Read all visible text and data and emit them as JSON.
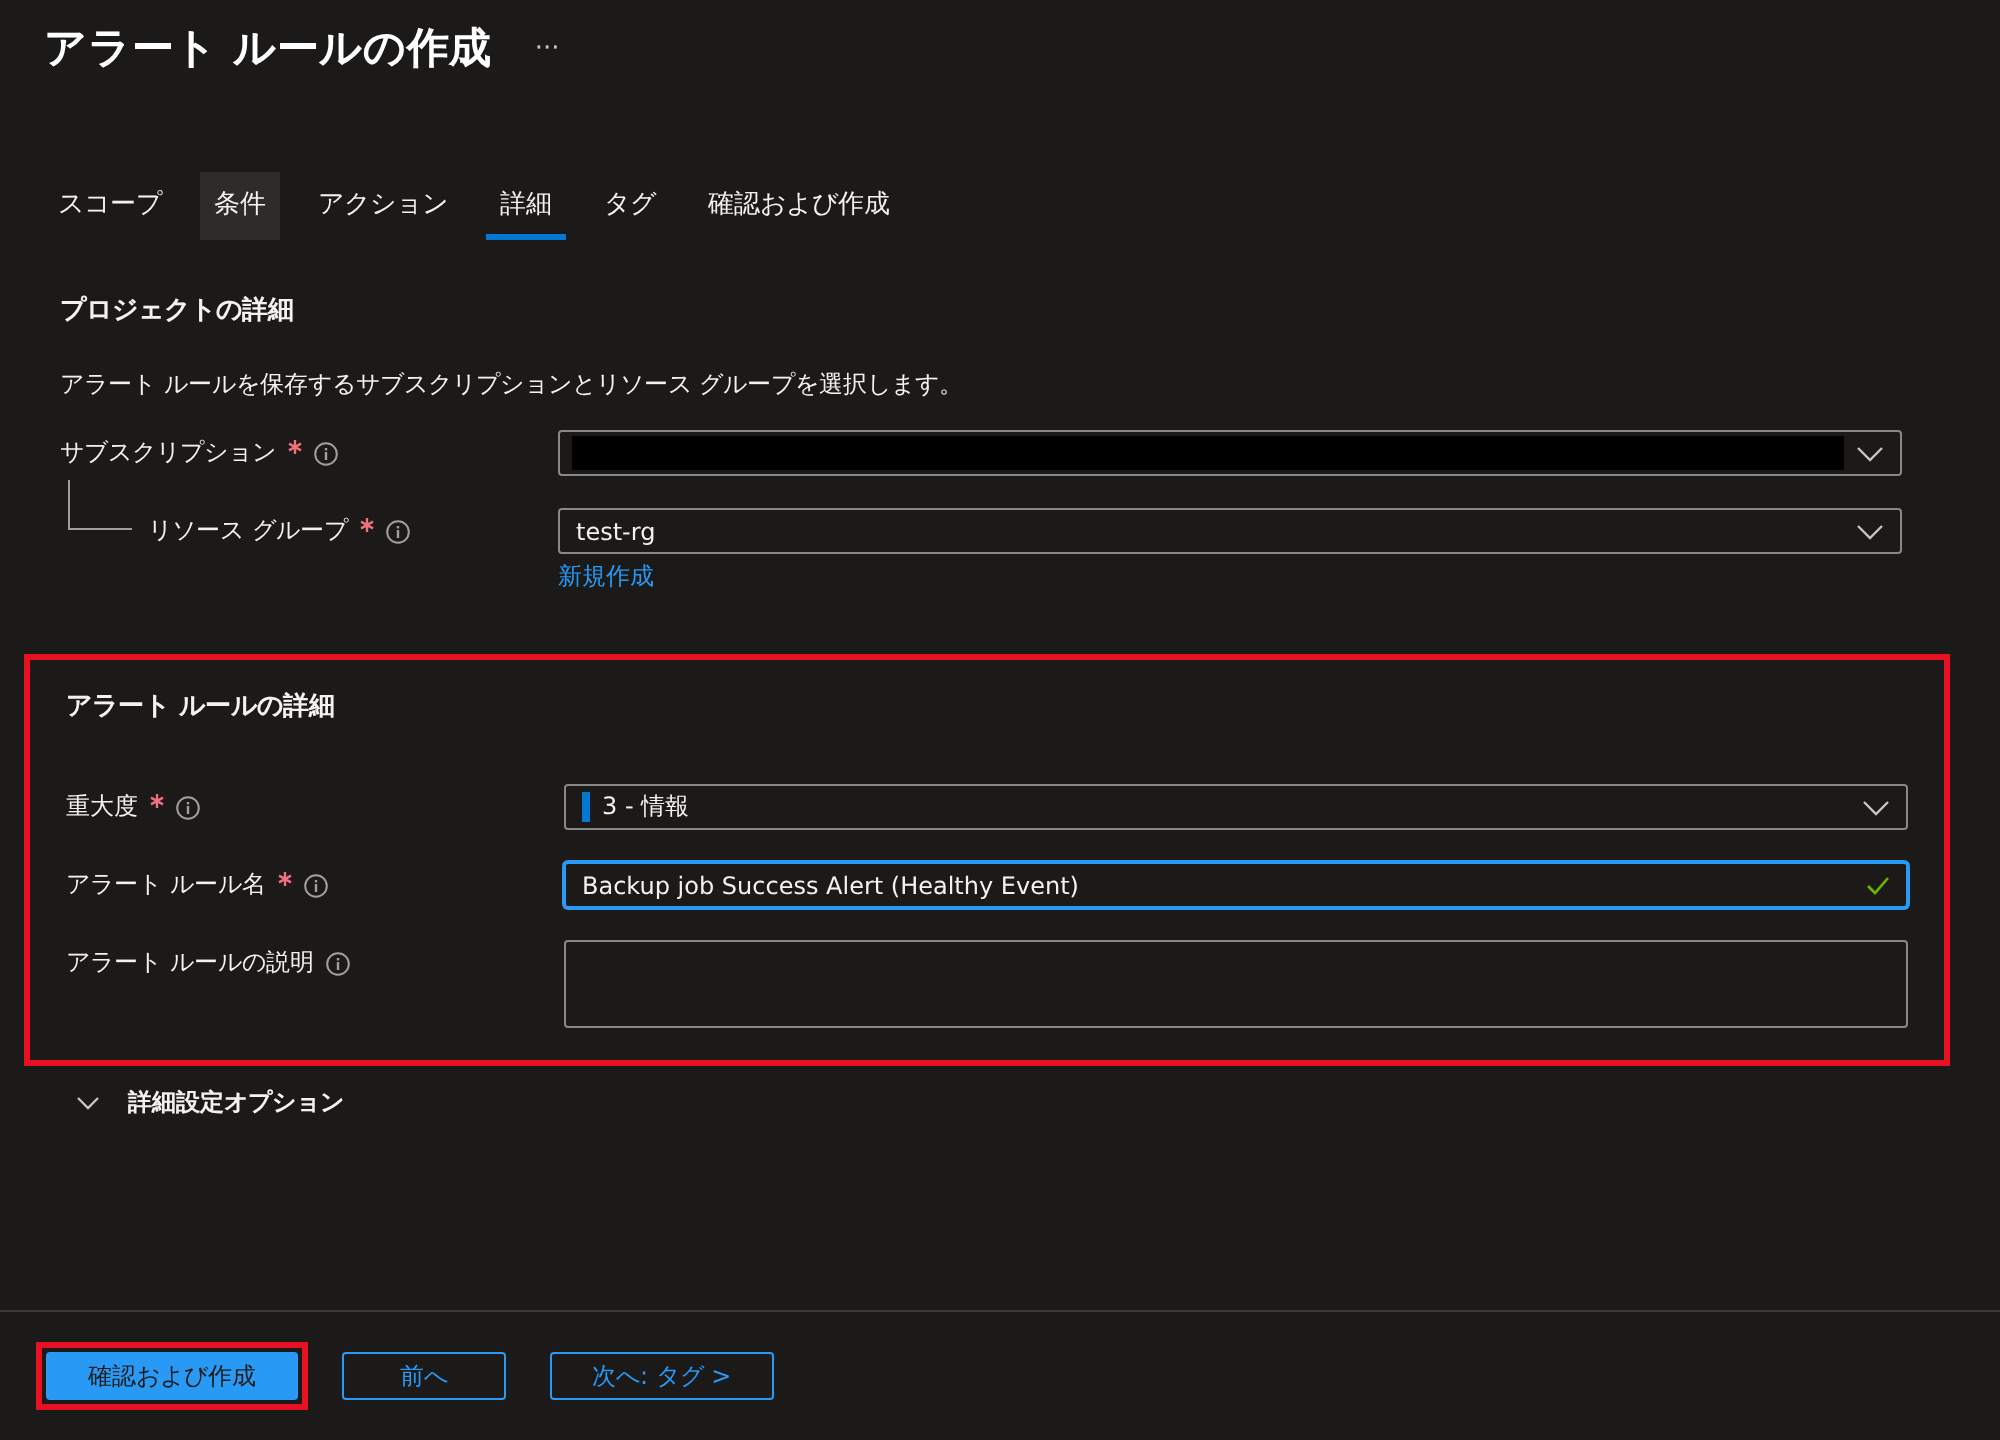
{
  "page": {
    "title": "アラート ルールの作成",
    "more": "···"
  },
  "tabs": [
    {
      "label": "スコープ",
      "selected": false,
      "hovered": false
    },
    {
      "label": "条件",
      "selected": false,
      "hovered": true
    },
    {
      "label": "アクション",
      "selected": false,
      "hovered": false
    },
    {
      "label": "詳細",
      "selected": true,
      "hovered": false
    },
    {
      "label": "タグ",
      "selected": false,
      "hovered": false
    },
    {
      "label": "確認および作成",
      "selected": false,
      "hovered": false
    }
  ],
  "project": {
    "heading": "プロジェクトの詳細",
    "description": "アラート ルールを保存するサブスクリプションとリソース グループを選択します。",
    "fields": [
      {
        "kind": "select",
        "label": "サブスクリプション",
        "required": true,
        "redacted": true,
        "children": [
          {
            "kind": "select",
            "label": "リソース グループ",
            "required": true,
            "redacted": false,
            "value": "test-rg",
            "link": "新規作成"
          }
        ]
      }
    ]
  },
  "rule_details": {
    "heading": "アラート ルールの詳細",
    "highlighted": true,
    "fields": [
      {
        "kind": "select",
        "label": "重大度",
        "required": true,
        "value": "3 - 情報",
        "color": "#0078d4"
      },
      {
        "kind": "text",
        "label": "アラート ルール名",
        "required": true,
        "value": "Backup job Success Alert (Healthy Event)",
        "focused": true,
        "valid": true
      },
      {
        "kind": "textarea",
        "label": "アラート ルールの説明",
        "required": false
      }
    ]
  },
  "advanced": {
    "label": "詳細設定オプション",
    "expanded": false
  },
  "footer": {
    "buttons": [
      {
        "label": "確認および作成",
        "kind": "primary",
        "highlighted": true
      },
      {
        "label": "前へ",
        "kind": "secondary",
        "highlighted": false
      },
      {
        "label": "次へ: タグ >",
        "kind": "secondary",
        "highlighted": false
      }
    ]
  }
}
